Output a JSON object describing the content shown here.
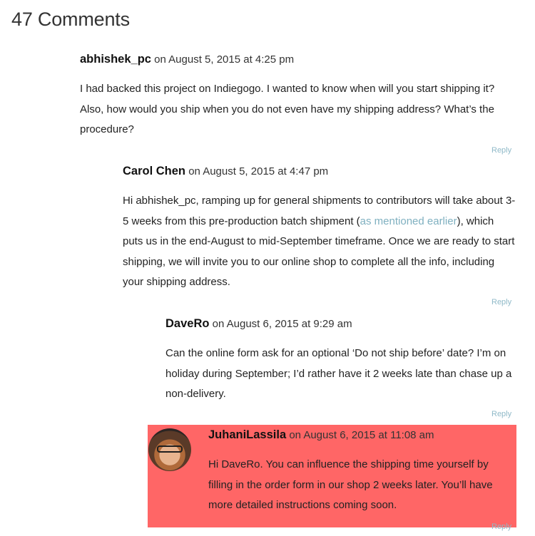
{
  "heading": "47 Comments",
  "comments": [
    {
      "author": "abhishek_pc",
      "date": "on August 5, 2015 at 4:25 pm",
      "text": "I had backed this project on Indiegogo. I wanted to know when will you start shipping it? Also, how would you ship when you do not even have my shipping address? What’s the procedure?",
      "reply": "Reply"
    },
    {
      "author": "Carol Chen",
      "date": "on August 5, 2015 at 4:47 pm",
      "text_before": "Hi abhishek_pc, ramping up for general shipments to contributors will take about 3-5 weeks from this pre-production batch shipment (",
      "link": "as mentioned earlier",
      "text_after": "), which puts us in the end-August to mid-September timeframe. Once we are ready to start shipping, we will invite you to our online shop to complete all the info, including your shipping address.",
      "reply": "Reply"
    },
    {
      "author": "DaveRo",
      "date": "on August 6, 2015 at 9:29 am",
      "text": "Can the online form ask for an optional ‘Do not ship before’ date? I’m on holiday during September; I’d rather have it 2 weeks late than chase up a non-delivery.",
      "reply": "Reply"
    },
    {
      "author": "JuhaniLassila",
      "date": "on August 6, 2015 at 11:08 am",
      "text": "Hi DaveRo. You can influence the shipping time yourself by filling in the order form in our shop 2 weeks later. You’ll have more detailed instructions coming soon.",
      "reply": "Reply"
    }
  ],
  "colors": {
    "highlight": "#ff6666",
    "link": "#7fb0c0"
  }
}
